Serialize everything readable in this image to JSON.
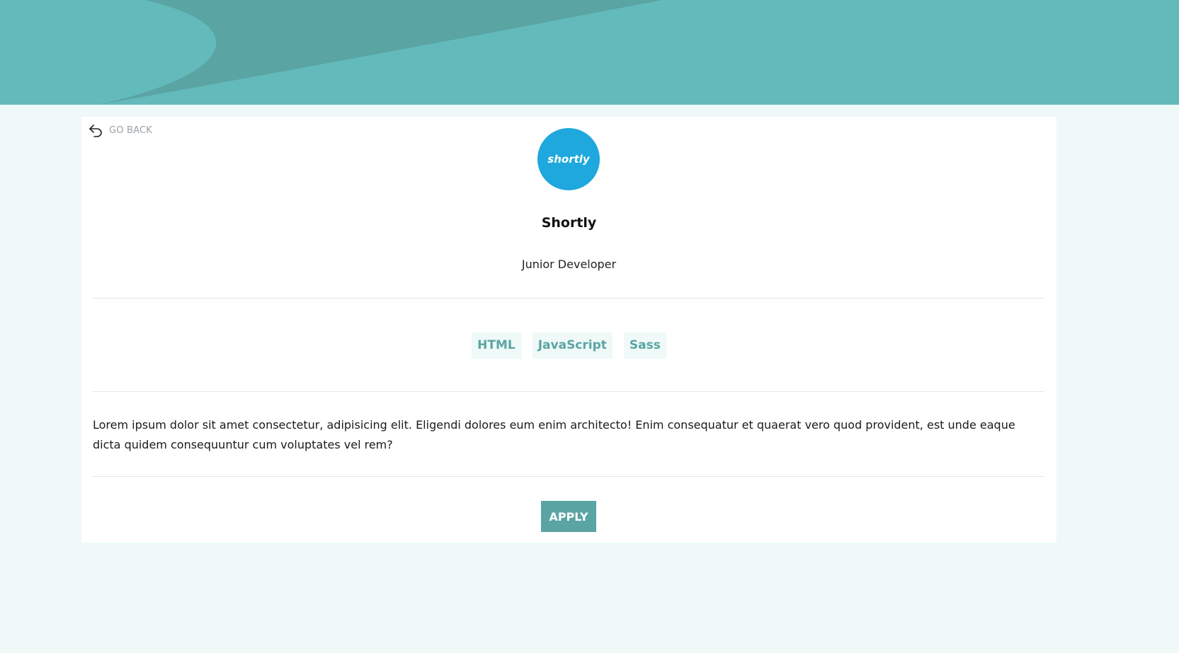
{
  "header": {
    "bg_color": "#63babb"
  },
  "nav": {
    "go_back_label": "GO BACK",
    "icon": "back-arrow-icon"
  },
  "job": {
    "logo_text": "shortly",
    "logo_color": "#1ea8dd",
    "company": "Shortly",
    "role": "Junior Developer",
    "tags": [
      "HTML",
      "JavaScript",
      "Sass"
    ],
    "description": "Lorem ipsum dolor sit amet consectetur, adipisicing elit. Eligendi dolores eum enim architecto! Enim consequatur et quaerat vero quod provident, est unde eaque dicta quidem consequuntur cum voluptates vel rem?",
    "apply_label": "APPLY"
  },
  "colors": {
    "accent": "#5ba4a4",
    "page_bg": "#eef9f8"
  }
}
